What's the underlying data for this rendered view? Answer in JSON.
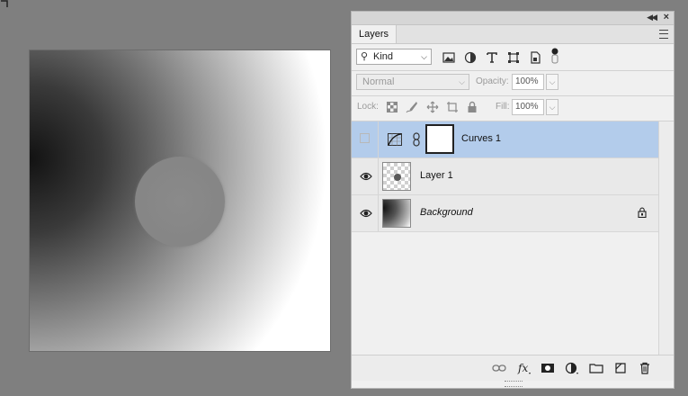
{
  "panel": {
    "tab_label": "Layers",
    "filter": {
      "kind_label": "Kind",
      "icons": [
        "image-filter-icon",
        "adjustment-filter-icon",
        "type-filter-icon",
        "shape-filter-icon",
        "smart-object-filter-icon",
        "filter-toggle-icon"
      ]
    },
    "blend_mode": "Normal",
    "opacity_label": "Opacity:",
    "opacity_value": "100%",
    "lock_label": "Lock:",
    "fill_label": "Fill:",
    "fill_value": "100%"
  },
  "layers": [
    {
      "name": "Curves 1",
      "visible": false,
      "selected": true,
      "type": "adjustment",
      "italic": false
    },
    {
      "name": "Layer 1",
      "visible": true,
      "selected": false,
      "type": "pixel",
      "italic": false
    },
    {
      "name": "Background",
      "visible": true,
      "selected": false,
      "type": "background",
      "italic": true,
      "locked": true
    }
  ],
  "footer_icons": [
    "link-layers-icon",
    "fx-icon",
    "add-mask-icon",
    "new-adjustment-icon",
    "new-group-icon",
    "new-layer-icon",
    "delete-layer-icon"
  ],
  "colors": {
    "selected_row": "#b3cceb",
    "workspace": "#7f7f7f",
    "panel_bg": "#f0f0f0"
  }
}
